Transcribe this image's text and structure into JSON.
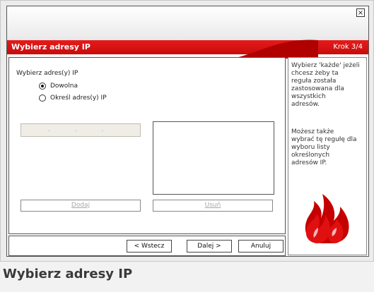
{
  "window": {
    "close_glyph": "×",
    "header": {
      "title": "Wybierz adresy IP",
      "step": "Krok 3/4"
    }
  },
  "content": {
    "label": "Wybierz adres(y) IP",
    "options": [
      {
        "label": "Dowolna",
        "selected": true
      },
      {
        "label": "Określ adres(y) IP",
        "selected": false
      }
    ],
    "ip_input": {
      "value": ". . .",
      "placeholder": ""
    },
    "add_label": "Dodaj",
    "remove_label": "Usuń"
  },
  "nav": {
    "back": "< Wstecz",
    "next": "Dalej >",
    "cancel": "Anuluj"
  },
  "help": {
    "para1": "Wybierz 'każde' jeżeli\nchcesz żeby ta\nreguła została\nzastosowana dla\nwszystkich\nadresów.",
    "para2": "Możesz także\nwybrać tę regułę dla\nwyboru listy\nokreślonych\nadresów IP."
  },
  "caption": "Wybierz adresy IP",
  "colors": {
    "accent": "#d81414",
    "accent_dark": "#b00000",
    "panel_border": "#555555"
  },
  "icons": {
    "close": "close-icon",
    "illustration": "flame-logo-icon"
  }
}
